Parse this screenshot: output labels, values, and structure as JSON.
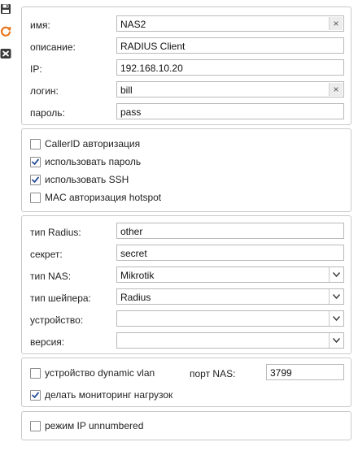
{
  "icons": {
    "save": "save-icon",
    "refresh": "refresh-icon",
    "close": "close-icon",
    "clear": "clear-x-icon",
    "dropdown": "chevron-down-icon",
    "check": "checkmark-icon"
  },
  "colors": {
    "accent_orange": "#e8761d",
    "toolbar_dark": "#3a3a3a",
    "border": "#c9c9c9"
  },
  "identity": {
    "name_label": "имя:",
    "name_value": "NAS2",
    "clear_symbol": "×",
    "description_label": "описание:",
    "description_value": "RADIUS Client",
    "ip_label": "IP:",
    "ip_value": "192.168.10.20",
    "login_label": "логин:",
    "login_value": "bill",
    "password_label": "пароль:",
    "password_value": "pass"
  },
  "auth_options": {
    "callerid": {
      "label": "CallerID авторизация",
      "checked": false
    },
    "use_password": {
      "label": "использовать пароль",
      "checked": true
    },
    "use_ssh": {
      "label": "использовать SSH",
      "checked": true
    },
    "mac_hotspot": {
      "label": "MAC авторизация hotspot",
      "checked": false
    }
  },
  "radius": {
    "radius_type_label": "тип Radius:",
    "radius_type_value": "other",
    "secret_label": "секрет:",
    "secret_value": "secret",
    "nas_type_label": "тип NAS:",
    "nas_type_value": "Mikrotik",
    "shaper_type_label": "тип шейпера:",
    "shaper_type_value": "Radius",
    "device_label": "устройство:",
    "device_value": "",
    "version_label": "версия:",
    "version_value": ""
  },
  "vlan": {
    "dynamic_vlan": {
      "label": "устройство dynamic vlan",
      "checked": false
    },
    "nas_port_label": "порт NAS:",
    "nas_port_value": "3799",
    "load_monitoring": {
      "label": "делать мониторинг нагрузок",
      "checked": true
    }
  },
  "ip_unnumbered": {
    "label": "режим IP unnumbered",
    "checked": false
  }
}
